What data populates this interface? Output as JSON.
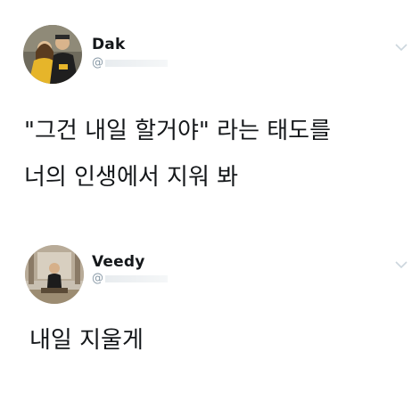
{
  "tweets": [
    {
      "author_name": "Dak",
      "author_handle": "@",
      "text_line1": "\"그건 내일 할거야\" 라는 태도를",
      "text_line2": "너의 인생에서 지워 봐",
      "avatar_icon": "profile-photo-icon",
      "caret_icon": "chevron-down-icon"
    },
    {
      "author_name": "Veedy",
      "author_handle": "@",
      "text_line1": "내일 지울게",
      "avatar_icon": "profile-photo-icon",
      "caret_icon": "chevron-down-icon"
    }
  ],
  "colors": {
    "text": "#14171a",
    "secondary": "#8899a6",
    "background": "#ffffff"
  }
}
